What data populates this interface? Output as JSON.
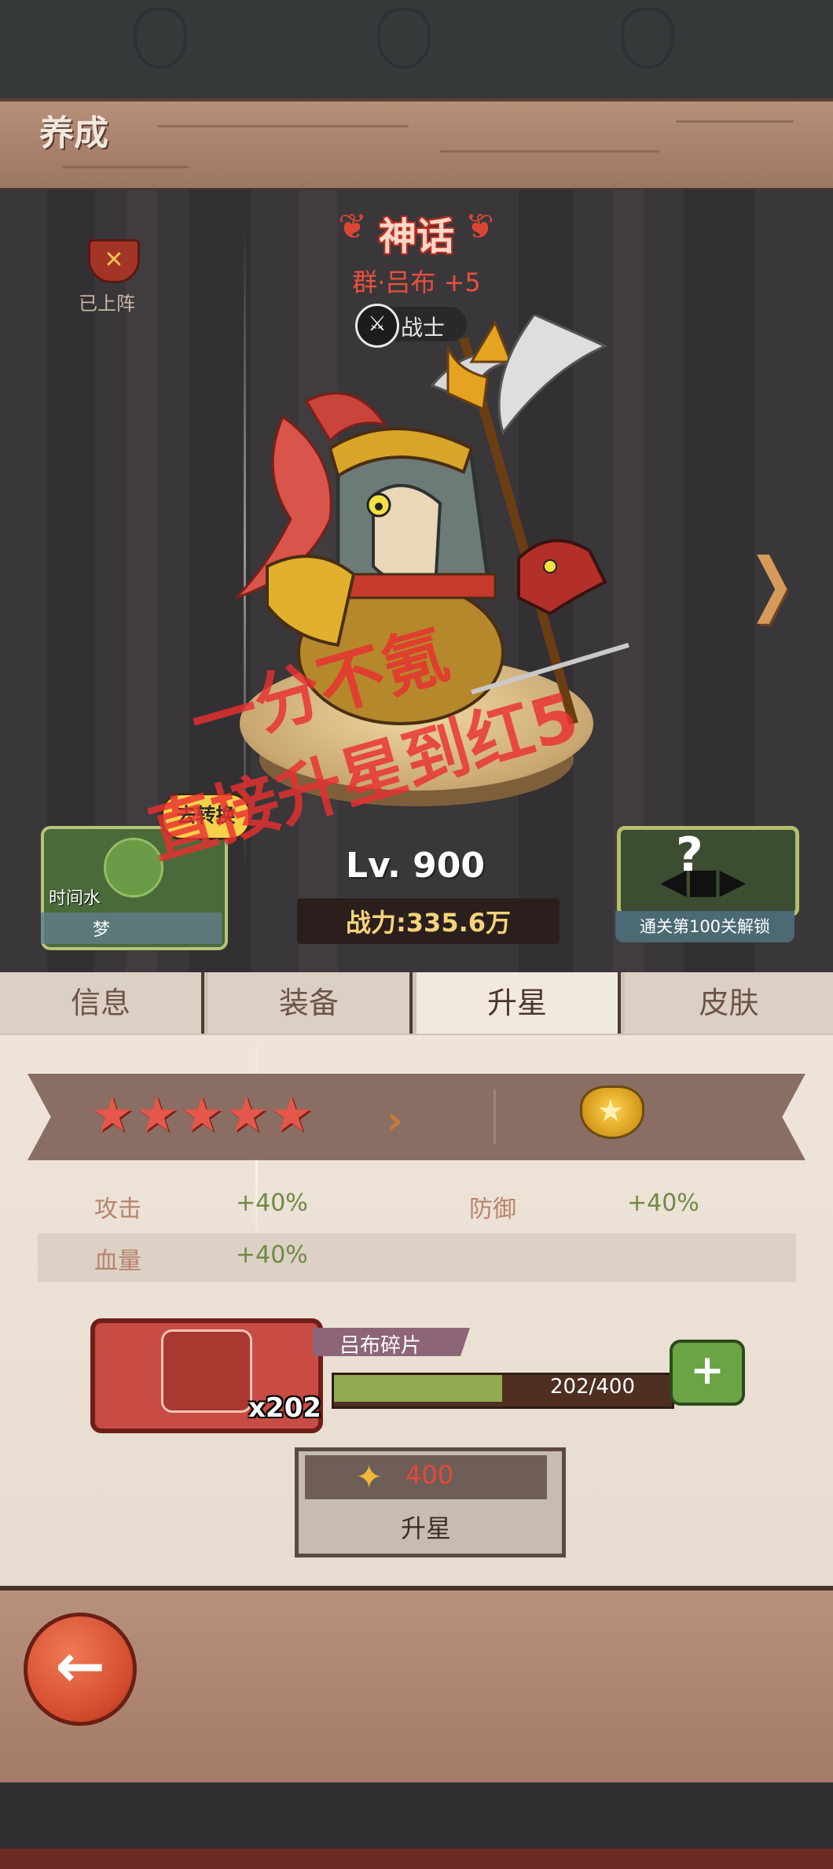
{
  "header": {
    "title": "养成"
  },
  "hero": {
    "rarity": "神话",
    "name": "群·吕布 +5",
    "role": "战士",
    "deployed": "已上阵",
    "level": "Lv. 900",
    "power": "战力:335.6万"
  },
  "left_card": {
    "badge": "去转换",
    "line1": "时间水",
    "line2": "梦"
  },
  "right_card": {
    "label": "通关第100关解锁",
    "icon": "question-fish-icon"
  },
  "watermark": {
    "line1": "一分不氪",
    "line2": "直接升星到红5"
  },
  "tabs": [
    {
      "label": "信息"
    },
    {
      "label": "装备"
    },
    {
      "label": "升星"
    },
    {
      "label": "皮肤"
    }
  ],
  "star_panel": {
    "current_stars": 5,
    "next_icon": "gold-crown-star-icon",
    "stats": [
      {
        "label": "攻击",
        "value": "+40%"
      },
      {
        "label": "防御",
        "value": "+40%"
      },
      {
        "label": "血量",
        "value": "+40%"
      }
    ]
  },
  "fragment": {
    "name": "吕布碎片",
    "count": "x202",
    "progress_text": "202/400",
    "progress": 0.505
  },
  "upgrade": {
    "cost": "400",
    "label": "升星"
  },
  "colors": {
    "accent_red": "#e4584c",
    "progress_green": "#93aa50",
    "gold": "#f4d37a"
  }
}
